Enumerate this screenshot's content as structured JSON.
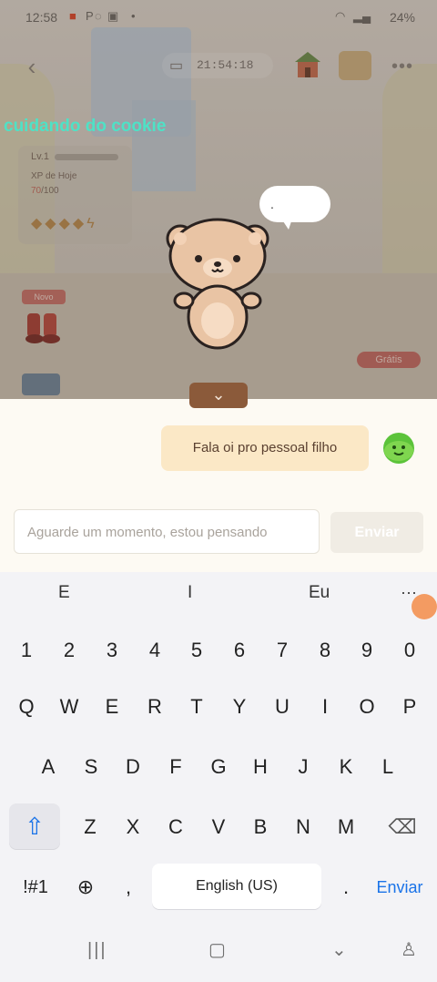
{
  "status_bar": {
    "time": "12:58",
    "battery": "24%",
    "icons": [
      "video-recording-icon",
      "p-icon",
      "image-icon",
      "dot-icon",
      "wifi-icon",
      "signal-icon",
      "battery-icon"
    ]
  },
  "game": {
    "timer": "21:54:18",
    "activity_label": "cuidando do cookie",
    "xp": {
      "title": "XP de Hoje",
      "value_current": "70",
      "value_max": "/100",
      "level_label": "Lv.1"
    },
    "bubble_text": ".",
    "free_badge": "Grátis",
    "mini_badge": "Novo"
  },
  "chat": {
    "messages": [
      {
        "from": "user",
        "text": "Fala oi pro pessoal filho"
      }
    ],
    "input_placeholder": "Aguarde um momento, estou pensando",
    "send_label": "Enviar"
  },
  "keyboard": {
    "suggestions": [
      "E",
      "I",
      "Eu"
    ],
    "more": "···",
    "numbers": [
      "1",
      "2",
      "3",
      "4",
      "5",
      "6",
      "7",
      "8",
      "9",
      "0"
    ],
    "row1": [
      "Q",
      "W",
      "E",
      "R",
      "T",
      "Y",
      "U",
      "I",
      "O",
      "P"
    ],
    "row2": [
      "A",
      "S",
      "D",
      "F",
      "G",
      "H",
      "J",
      "K",
      "L"
    ],
    "row3": [
      "Z",
      "X",
      "C",
      "V",
      "B",
      "N",
      "M"
    ],
    "symbols_label": "!#1",
    "comma": ",",
    "space_label": "English (US)",
    "period": ".",
    "enter_label": "Enviar"
  },
  "colors": {
    "activity_label": "#4ee2c6",
    "message_bubble": "#fbe8c6",
    "enter_key": "#1a73e8",
    "shift_active": "#1a73e8"
  }
}
